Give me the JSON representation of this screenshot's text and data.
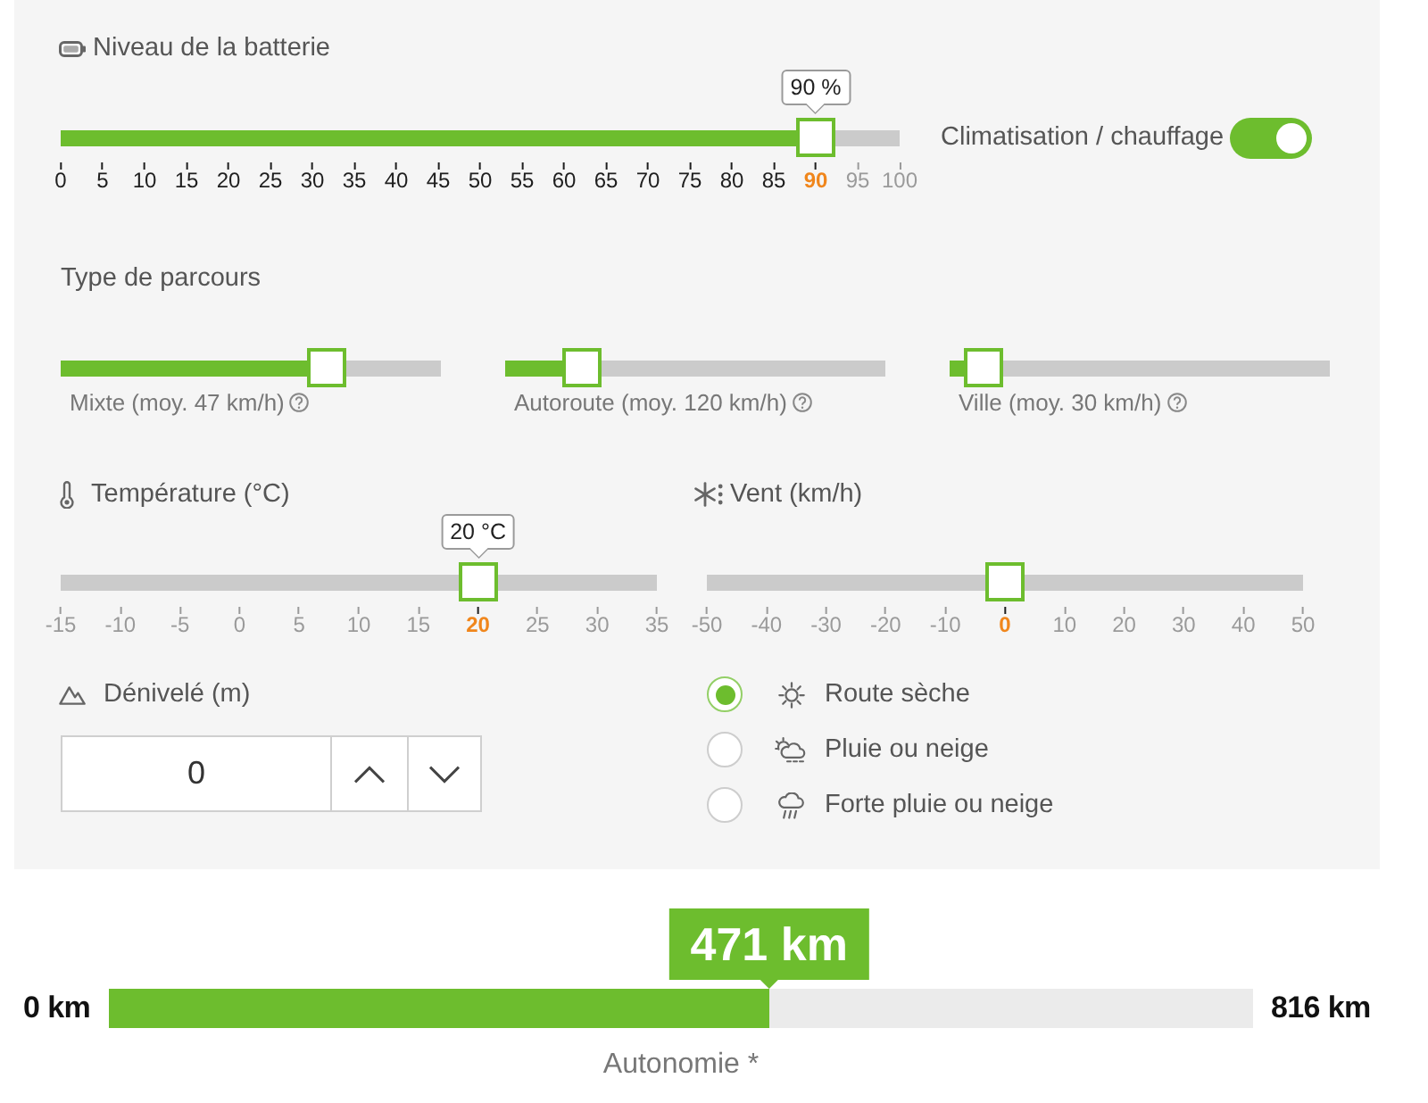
{
  "battery": {
    "label": "Niveau de la batterie",
    "slider": {
      "level": 0.9,
      "fill": true,
      "tooltip": "90 %",
      "ticks": [
        {
          "label": "0",
          "selected": false
        },
        {
          "label": "5",
          "selected": false
        },
        {
          "label": "10",
          "selected": false
        },
        {
          "label": "15",
          "selected": false
        },
        {
          "label": "20",
          "selected": false
        },
        {
          "label": "25",
          "selected": false
        },
        {
          "label": "30",
          "selected": false
        },
        {
          "label": "35",
          "selected": false
        },
        {
          "label": "40",
          "selected": false
        },
        {
          "label": "45",
          "selected": false
        },
        {
          "label": "50",
          "selected": false
        },
        {
          "label": "55",
          "selected": false
        },
        {
          "label": "60",
          "selected": false
        },
        {
          "label": "65",
          "selected": false
        },
        {
          "label": "70",
          "selected": false
        },
        {
          "label": "75",
          "selected": false
        },
        {
          "label": "80",
          "selected": false
        },
        {
          "label": "85",
          "selected": false
        },
        {
          "label": "90",
          "selected": true
        },
        {
          "label": "95",
          "selected": false
        },
        {
          "label": "100",
          "selected": false
        }
      ]
    }
  },
  "climate": {
    "label": "Climatisation / chauffage",
    "on": true
  },
  "route_type": {
    "title": "Type de parcours",
    "sliders": [
      {
        "level": 0.7,
        "fill": true,
        "caption": "Mixte (moy. 47 km/h)"
      },
      {
        "level": 0.2,
        "fill": true,
        "caption": "Autoroute (moy. 120 km/h)"
      },
      {
        "level": 0.09,
        "fill": true,
        "caption": "Ville (moy. 30 km/h)"
      }
    ]
  },
  "temperature": {
    "label": "Température (°C)",
    "slider": {
      "level": 0.7,
      "fill": false,
      "tooltip": "20 °C",
      "ticks": [
        {
          "label": "-15",
          "selected": false
        },
        {
          "label": "-10",
          "selected": false
        },
        {
          "label": "-5",
          "selected": false
        },
        {
          "label": "0",
          "selected": false
        },
        {
          "label": "5",
          "selected": false
        },
        {
          "label": "10",
          "selected": false
        },
        {
          "label": "15",
          "selected": false
        },
        {
          "label": "20",
          "selected": true
        },
        {
          "label": "25",
          "selected": false
        },
        {
          "label": "30",
          "selected": false
        },
        {
          "label": "35",
          "selected": false
        }
      ]
    }
  },
  "wind": {
    "label": "Vent (km/h)",
    "slider": {
      "level": 0.5,
      "fill": false,
      "ticks": [
        {
          "label": "-50",
          "selected": false
        },
        {
          "label": "-40",
          "selected": false
        },
        {
          "label": "-30",
          "selected": false
        },
        {
          "label": "-20",
          "selected": false
        },
        {
          "label": "-10",
          "selected": false
        },
        {
          "label": "0",
          "selected": true
        },
        {
          "label": "10",
          "selected": false
        },
        {
          "label": "20",
          "selected": false
        },
        {
          "label": "30",
          "selected": false
        },
        {
          "label": "40",
          "selected": false
        },
        {
          "label": "50",
          "selected": false
        }
      ]
    }
  },
  "elevation": {
    "label": "Dénivelé (m)",
    "value": "0"
  },
  "road_conditions": [
    {
      "label": "Route sèche",
      "selected": true,
      "kind": "dry"
    },
    {
      "label": "Pluie ou neige",
      "selected": false,
      "kind": "rain"
    },
    {
      "label": "Forte pluie ou neige",
      "selected": false,
      "kind": "heavy_rain"
    }
  ],
  "range": {
    "min": "0 km",
    "value": "471 km",
    "max": "816 km",
    "level": 0.577,
    "caption": "Autonomie *"
  }
}
